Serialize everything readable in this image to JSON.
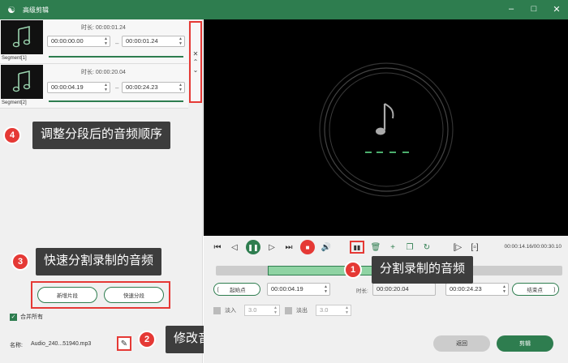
{
  "window": {
    "title": "高级剪辑"
  },
  "segments": [
    {
      "label": "Segment[1]",
      "duration_label": "时长:",
      "duration": "00:00:01.24",
      "start": "00:00:00.00",
      "end": "00:00:01.24",
      "progress": 1.0
    },
    {
      "label": "Segment[2]",
      "duration_label": "时长:",
      "duration": "00:00:20.04",
      "start": "00:00:04.19",
      "end": "00:00:24.23",
      "progress": 1.0
    }
  ],
  "callouts": [
    {
      "num": "4",
      "text": "调整分段后的音频顺序"
    },
    {
      "num": "3",
      "text": "快速分割录制的音频"
    },
    {
      "num": "1",
      "text": "分割录制的音频"
    },
    {
      "num": "2",
      "text": "修改音频文件的名称"
    }
  ],
  "left_buttons": {
    "new_segment": "新增片段",
    "quick_split": "快速分段"
  },
  "merge": {
    "label": "合并所有",
    "checked": true
  },
  "file": {
    "name_label": "名称:",
    "name": "Audio_240...51940.mp3"
  },
  "player": {
    "timecode": "00:00:14.16/00:00:30.10",
    "selection_start": 0.15,
    "selection_end": 0.47
  },
  "range": {
    "start_label": "起始点",
    "start": "00:00:04.19",
    "duration_label": "时长:",
    "duration": "00:00:20.04",
    "end": "00:00:24.23",
    "end_label": "结束点"
  },
  "fade": {
    "in_label": "淡入",
    "in_value": "3.0",
    "out_label": "淡出",
    "out_value": "3.0"
  },
  "footer": {
    "back": "返回",
    "ok": "剪辑"
  },
  "colors": {
    "accent": "#2e7d4f",
    "highlight": "#e53935",
    "callout_bg": "#3d3d3d"
  }
}
